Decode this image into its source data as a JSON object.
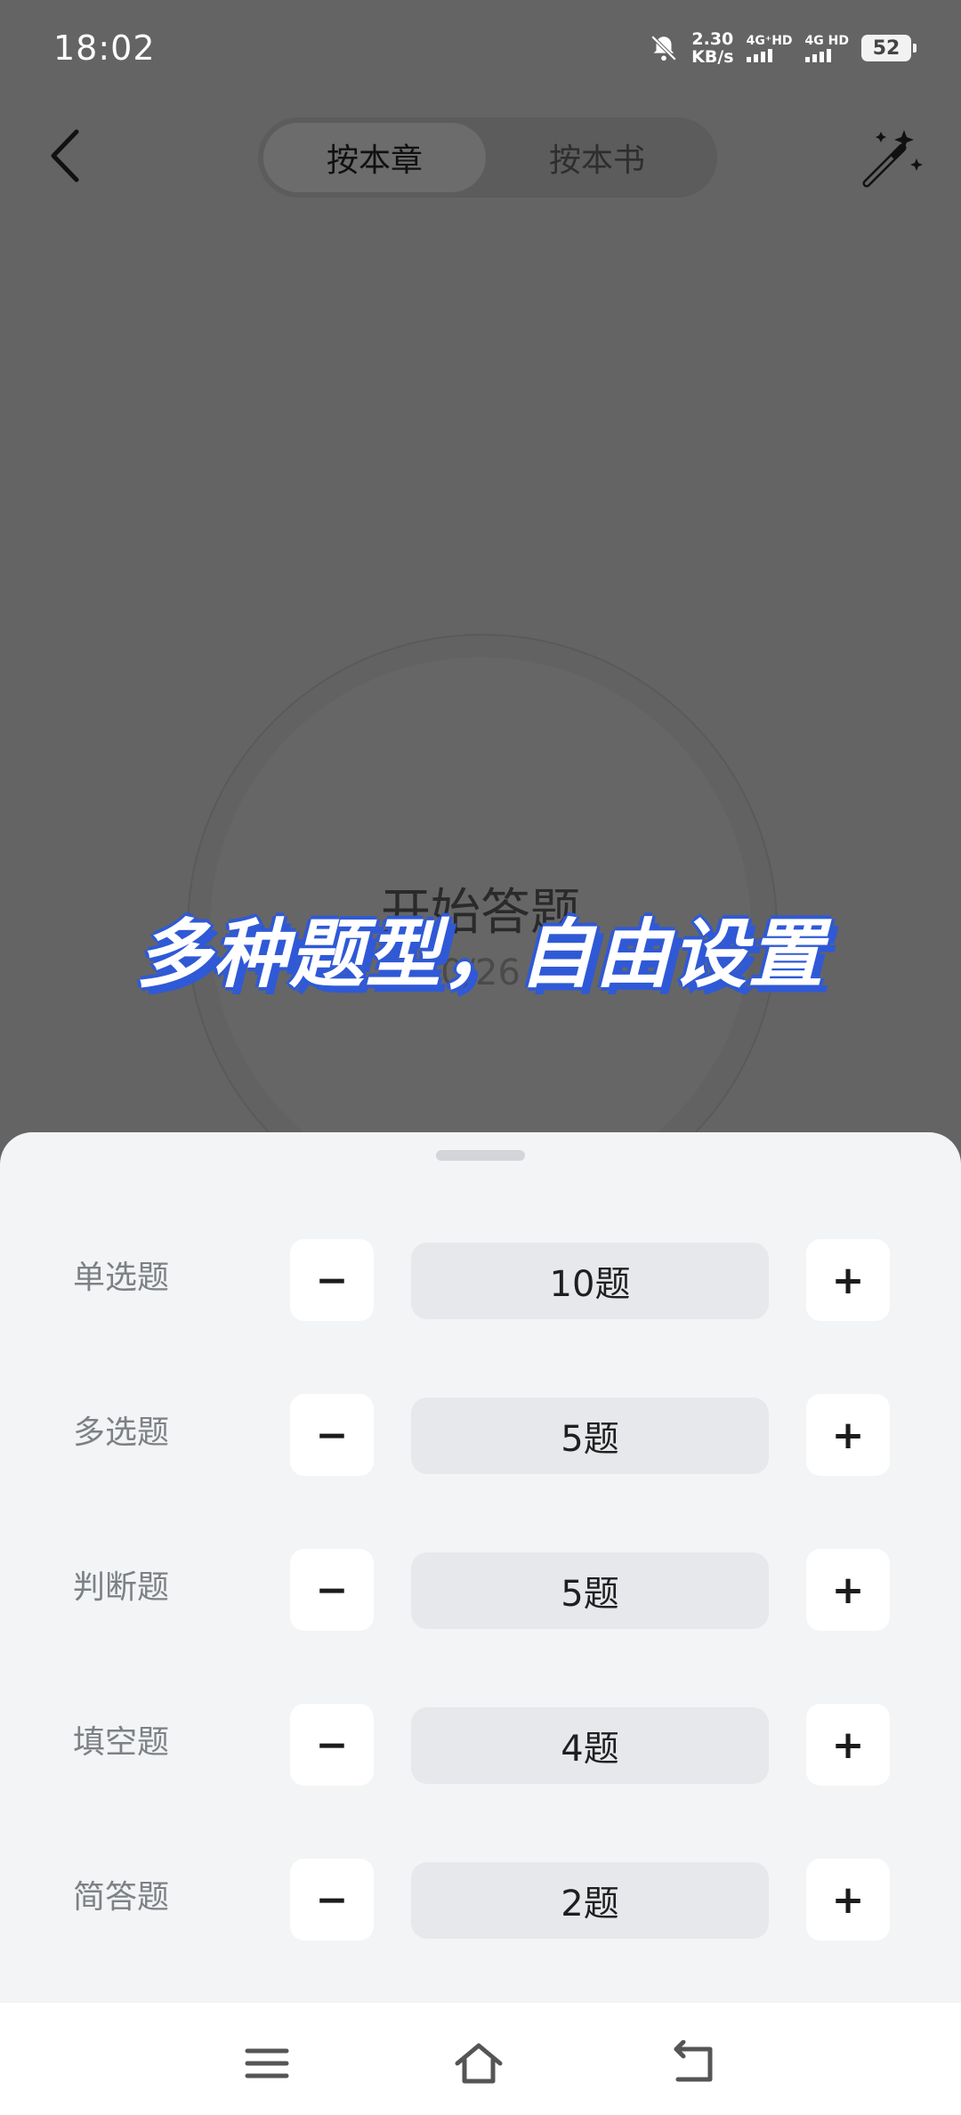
{
  "status_bar": {
    "time": "18:02",
    "speed_value": "2.30",
    "speed_unit": "KB/s",
    "sim1_label": "4G⁺HD",
    "sim2_label": "4G HD",
    "battery": "52"
  },
  "header": {
    "tabs": [
      {
        "label": "按本章",
        "active": true
      },
      {
        "label": "按本书",
        "active": false
      }
    ]
  },
  "main": {
    "start_label": "开始答题",
    "start_count": "0/26"
  },
  "caption": "多种题型，自由设置",
  "sheet": {
    "rows": [
      {
        "label": "单选题",
        "value": "10题"
      },
      {
        "label": "多选题",
        "value": "5题"
      },
      {
        "label": "判断题",
        "value": "5题"
      },
      {
        "label": "填空题",
        "value": "4题"
      },
      {
        "label": "简答题",
        "value": "2题"
      }
    ],
    "minus_symbol": "−",
    "plus_symbol": "+"
  },
  "colors": {
    "caption_outline": "#2f59d6",
    "sheet_background": "#f2f4f5",
    "dim_overlay": "#646464"
  },
  "icons": [
    "bell-off-icon",
    "back-arrow-icon",
    "magic-wand-icon",
    "menu-icon",
    "home-icon",
    "back-icon"
  ]
}
